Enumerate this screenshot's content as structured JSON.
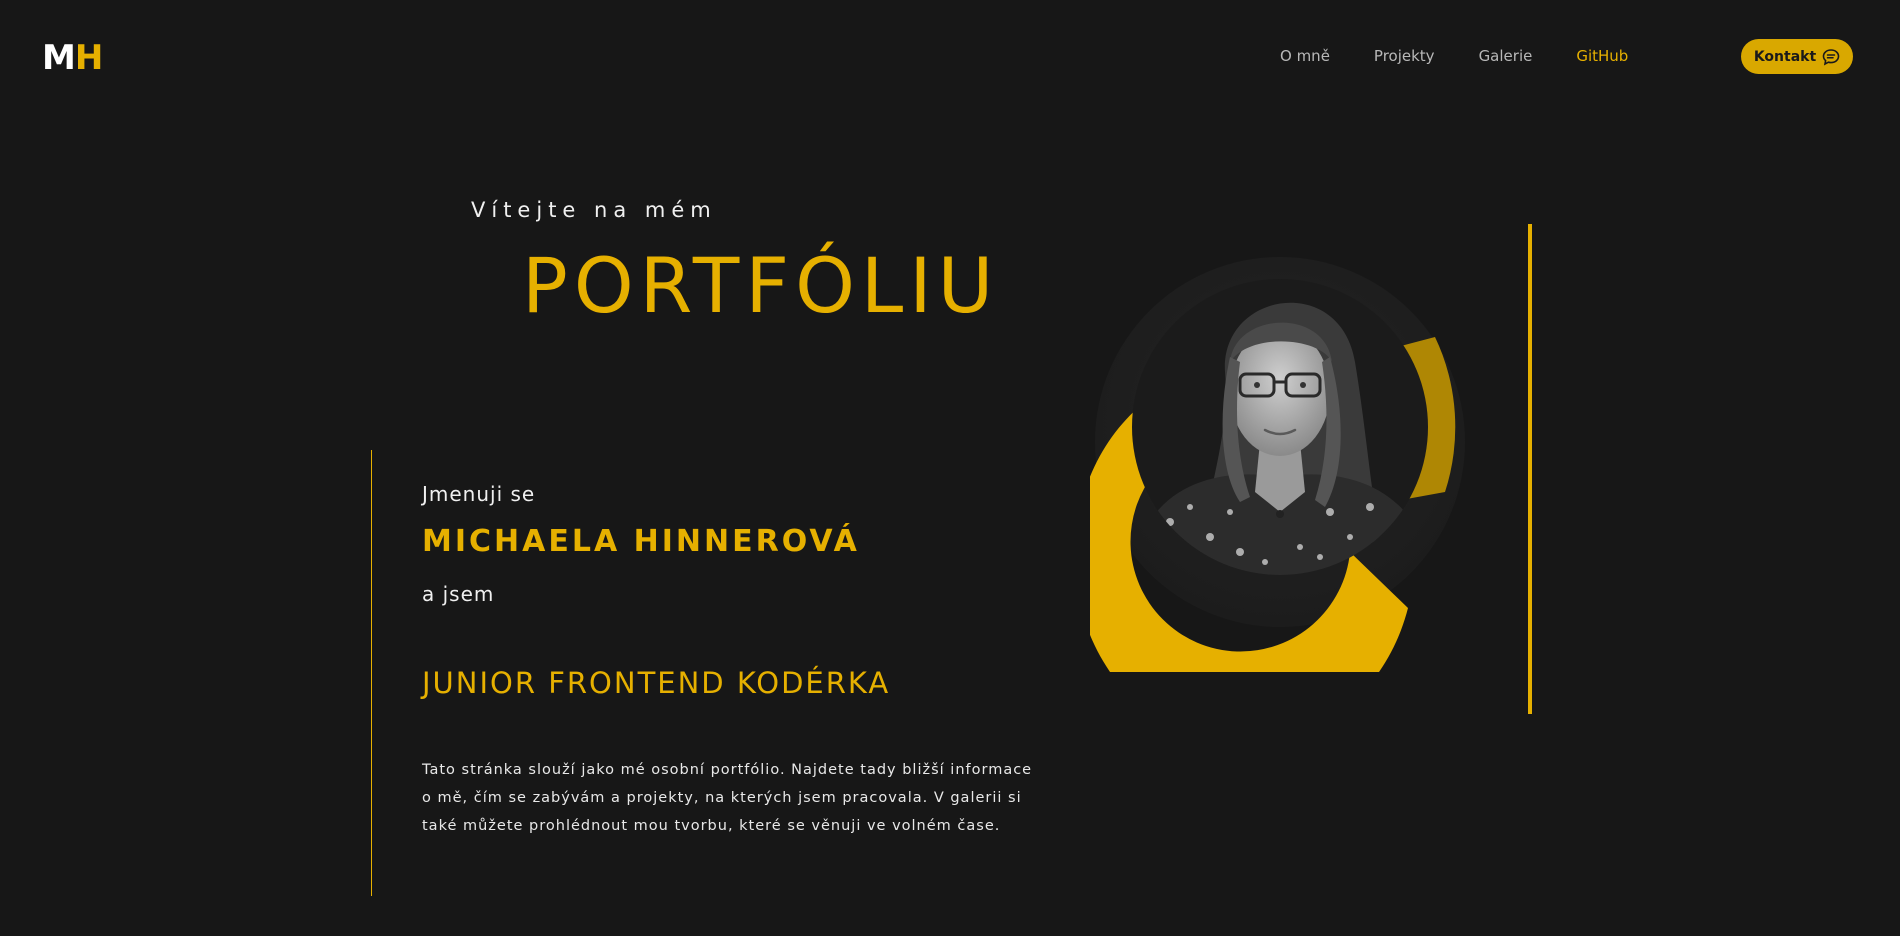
{
  "header": {
    "logo_m": "M",
    "logo_h": "H",
    "nav": [
      {
        "label": "O mně",
        "active": false
      },
      {
        "label": "Projekty",
        "active": false
      },
      {
        "label": "Galerie",
        "active": false
      },
      {
        "label": "GitHub",
        "active": true
      }
    ],
    "contact_label": "Kontakt",
    "contact_icon": "chat-bubble-icon"
  },
  "hero": {
    "welcome": "Vítejte na mém",
    "title": "PORTFÓLIU",
    "intro": "Jmenuji se",
    "name": "MICHAELA HINNEROVÁ",
    "and_i_am": "a jsem",
    "role": "JUNIOR FRONTEND KODÉRKA",
    "description": "Tato stránka slouží jako mé osobní portfólio. Najdete tady bližší informace o mě, čím se zabývám a projekty, na kterých jsem pracovala. V galerii si také můžete prohlédnout mou tvorbu, které se věnuji ve volném čase."
  },
  "colors": {
    "background": "#171717",
    "accent": "#e6b000",
    "text": "#f0f0f0",
    "nav_text": "#b8b8b8"
  }
}
